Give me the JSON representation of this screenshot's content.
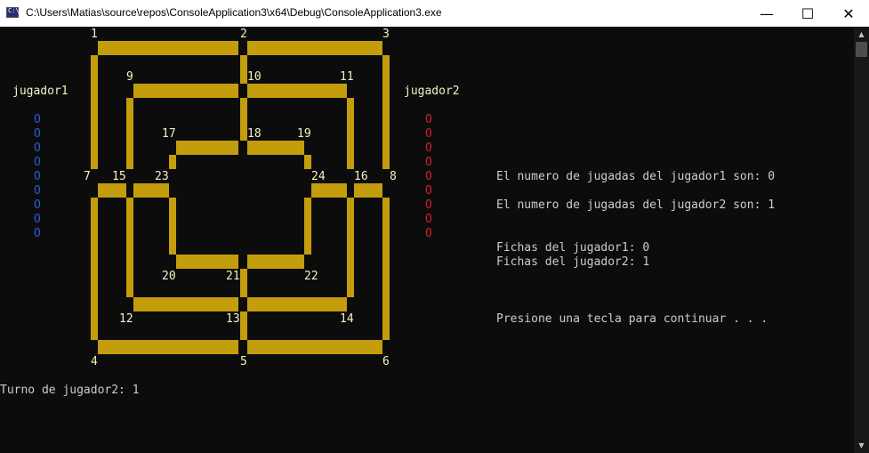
{
  "window": {
    "title": "C:\\Users\\Matias\\source\\repos\\ConsoleApplication3\\x64\\Debug\\ConsoleApplication3.exe",
    "minimize_icon": "minimize-icon",
    "maximize_icon": "maximize-icon",
    "close_icon": "close-icon",
    "minimize_glyph": "—",
    "maximize_glyph": "☐",
    "close_glyph": "✕"
  },
  "colors": {
    "background": "#0c0c0c",
    "board": "#c39d0c",
    "player1_pieces": "#2a5bd7",
    "player2_pieces": "#d21e2a",
    "text": "#cccccc"
  },
  "board": {
    "points": [
      "1",
      "2",
      "3",
      "4",
      "5",
      "6",
      "7",
      "8",
      "9",
      "10",
      "11",
      "12",
      "13",
      "14",
      "15",
      "16",
      "17",
      "18",
      "19",
      "20",
      "21",
      "22",
      "23",
      "24"
    ]
  },
  "players": {
    "player1": {
      "label": "jugador1",
      "pieces": [
        "O",
        "O",
        "O",
        "O",
        "O",
        "O",
        "O",
        "O",
        "O"
      ]
    },
    "player2": {
      "label": "jugador2",
      "pieces": [
        "O",
        "O",
        "O",
        "O",
        "O",
        "O",
        "O",
        "O",
        "O"
      ]
    }
  },
  "info": {
    "moves_player1": "El numero de jugadas del jugador1 son: 0",
    "moves_player2": "El numero de jugadas del jugador2 son: 1",
    "chips_player1": "Fichas del jugador1: 0",
    "chips_player2": "Fichas del jugador2: 1",
    "continue_prompt": "Presione una tecla para continuar . . ."
  },
  "turn": "Turno de jugador2: 1"
}
